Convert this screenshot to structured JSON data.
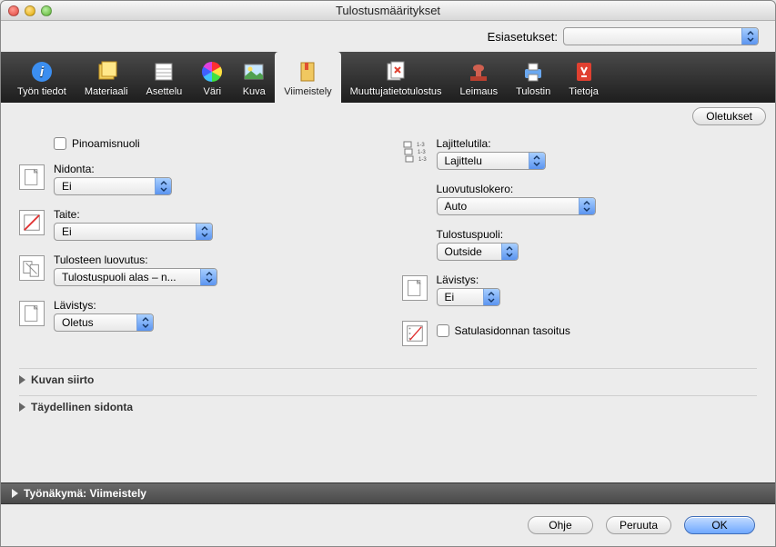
{
  "window_title": "Tulostusmääritykset",
  "presets_label": "Esiasetukset:",
  "presets_value": "",
  "toolbar": [
    {
      "id": "job",
      "label": "Työn tiedot"
    },
    {
      "id": "material",
      "label": "Materiaali"
    },
    {
      "id": "layout",
      "label": "Asettelu"
    },
    {
      "id": "color",
      "label": "Väri"
    },
    {
      "id": "image",
      "label": "Kuva"
    },
    {
      "id": "finishing",
      "label": "Viimeistely"
    },
    {
      "id": "vdp",
      "label": "Muuttujatietotulostus"
    },
    {
      "id": "stamp",
      "label": "Leimaus"
    },
    {
      "id": "printer",
      "label": "Tulostin"
    },
    {
      "id": "info",
      "label": "Tietoja"
    }
  ],
  "defaults_button": "Oletukset",
  "left": {
    "stack_arrow": "Pinoamisnuoli",
    "stapling": {
      "label": "Nidonta:",
      "value": "Ei"
    },
    "fold": {
      "label": "Taite:",
      "value": "Ei"
    },
    "output_delivery": {
      "label": "Tulosteen luovutus:",
      "value": "Tulostuspuoli alas – n..."
    },
    "punch": {
      "label": "Lävistys:",
      "value": "Oletus"
    }
  },
  "right": {
    "sort_mode": {
      "label": "Lajittelutila:",
      "value": "Lajittelu"
    },
    "output_tray": {
      "label": "Luovutuslokero:",
      "value": "Auto"
    },
    "print_side": {
      "label": "Tulostuspuoli:",
      "value": "Outside"
    },
    "perforation": {
      "label": "Lävistys:",
      "value": "Ei"
    },
    "saddle": "Satulasidonnan tasoitus"
  },
  "disclosures": {
    "image_shift": "Kuvan siirto",
    "perfect_binding": "Täydellinen sidonta"
  },
  "status_bar": "Työnäkymä: Viimeistely",
  "footer": {
    "help": "Ohje",
    "cancel": "Peruuta",
    "ok": "OK"
  }
}
